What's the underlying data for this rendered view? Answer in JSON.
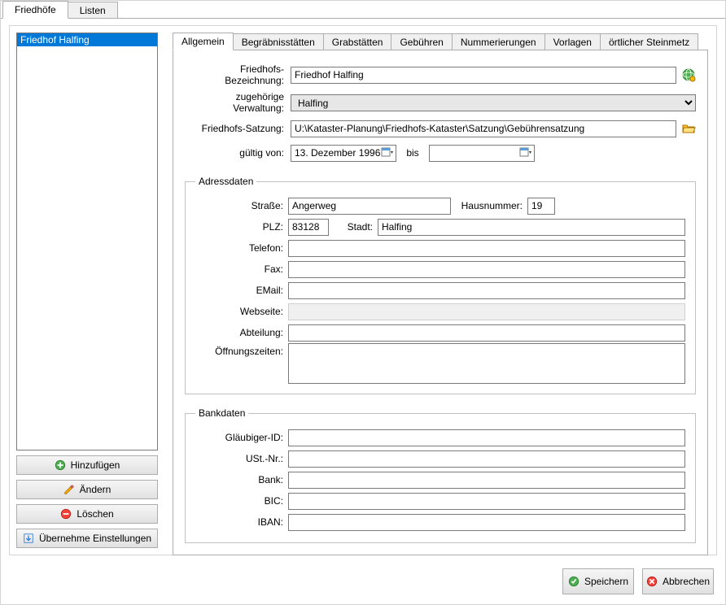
{
  "top_tabs": {
    "t0": "Friedhöfe",
    "t1": "Listen"
  },
  "sidebar": {
    "items": [
      "Friedhof Halfing"
    ],
    "btn_add": "Hinzufügen",
    "btn_edit": "Ändern",
    "btn_delete": "Löschen",
    "btn_import": "Übernehme Einstellungen"
  },
  "inner_tabs": {
    "t0": "Allgemein",
    "t1": "Begräbnisstätten",
    "t2": "Grabstätten",
    "t3": "Gebühren",
    "t4": "Nummerierungen",
    "t5": "Vorlagen",
    "t6": "örtlicher Steinmetz"
  },
  "general": {
    "lbl_name": "Friedhofs-Bezeichnung:",
    "name": "Friedhof Halfing",
    "lbl_admin": "zugehörige Verwaltung:",
    "admin": "Halfing",
    "lbl_statute": "Friedhofs-Satzung:",
    "statute": "U:\\Kataster-Planung\\Friedhofs-Kataster\\Satzung\\Gebührensatzung",
    "lbl_valid_from": "gültig von:",
    "valid_from": "13. Dezember  1996",
    "lbl_valid_to": "bis",
    "valid_to": ""
  },
  "address": {
    "legend": "Adressdaten",
    "lbl_street": "Straße:",
    "street": "Angerweg",
    "lbl_houseno": "Hausnummer:",
    "houseno": "19",
    "lbl_zip": "PLZ:",
    "zip": "83128",
    "lbl_city": "Stadt:",
    "city": "Halfing",
    "lbl_phone": "Telefon:",
    "phone": "",
    "lbl_fax": "Fax:",
    "fax": "",
    "lbl_email": "EMail:",
    "email": "",
    "lbl_website": "Webseite:",
    "website": "",
    "lbl_department": "Abteilung:",
    "department": "",
    "lbl_hours": "Öffnungszeiten:",
    "hours": ""
  },
  "bank": {
    "legend": "Bankdaten",
    "lbl_creditor": "Gläubiger-ID:",
    "creditor": "",
    "lbl_vat": "USt.-Nr.:",
    "vat": "",
    "lbl_bank": "Bank:",
    "bank_name": "",
    "lbl_bic": "BIC:",
    "bic": "",
    "lbl_iban": "IBAN:",
    "iban": ""
  },
  "footer": {
    "save": "Speichern",
    "cancel": "Abbrechen"
  }
}
